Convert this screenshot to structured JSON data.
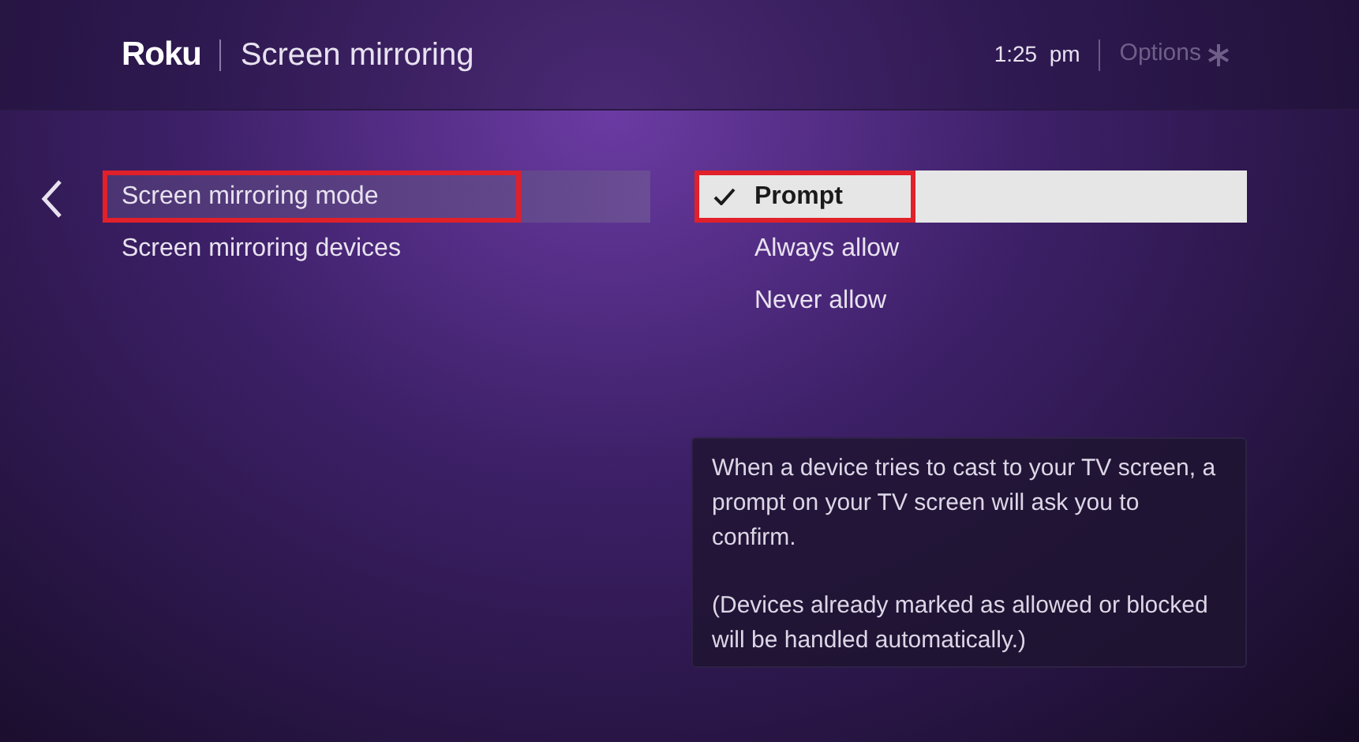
{
  "header": {
    "logo": "Roku",
    "title": "Screen mirroring",
    "time": "1:25  pm",
    "options": "Options"
  },
  "menu": [
    {
      "label": "Screen mirroring mode",
      "selected": true,
      "annotated": true
    },
    {
      "label": "Screen mirroring devices",
      "selected": false,
      "annotated": false
    }
  ],
  "options": [
    {
      "label": "Prompt",
      "selected": true,
      "annotated": true
    },
    {
      "label": "Always allow",
      "selected": false,
      "annotated": false
    },
    {
      "label": "Never allow",
      "selected": false,
      "annotated": false
    }
  ],
  "info": [
    "When a device tries to cast to your TV screen, a prompt on your TV screen will ask you to confirm.",
    "(Devices already marked as allowed or blocked will be handled automatically.)"
  ]
}
